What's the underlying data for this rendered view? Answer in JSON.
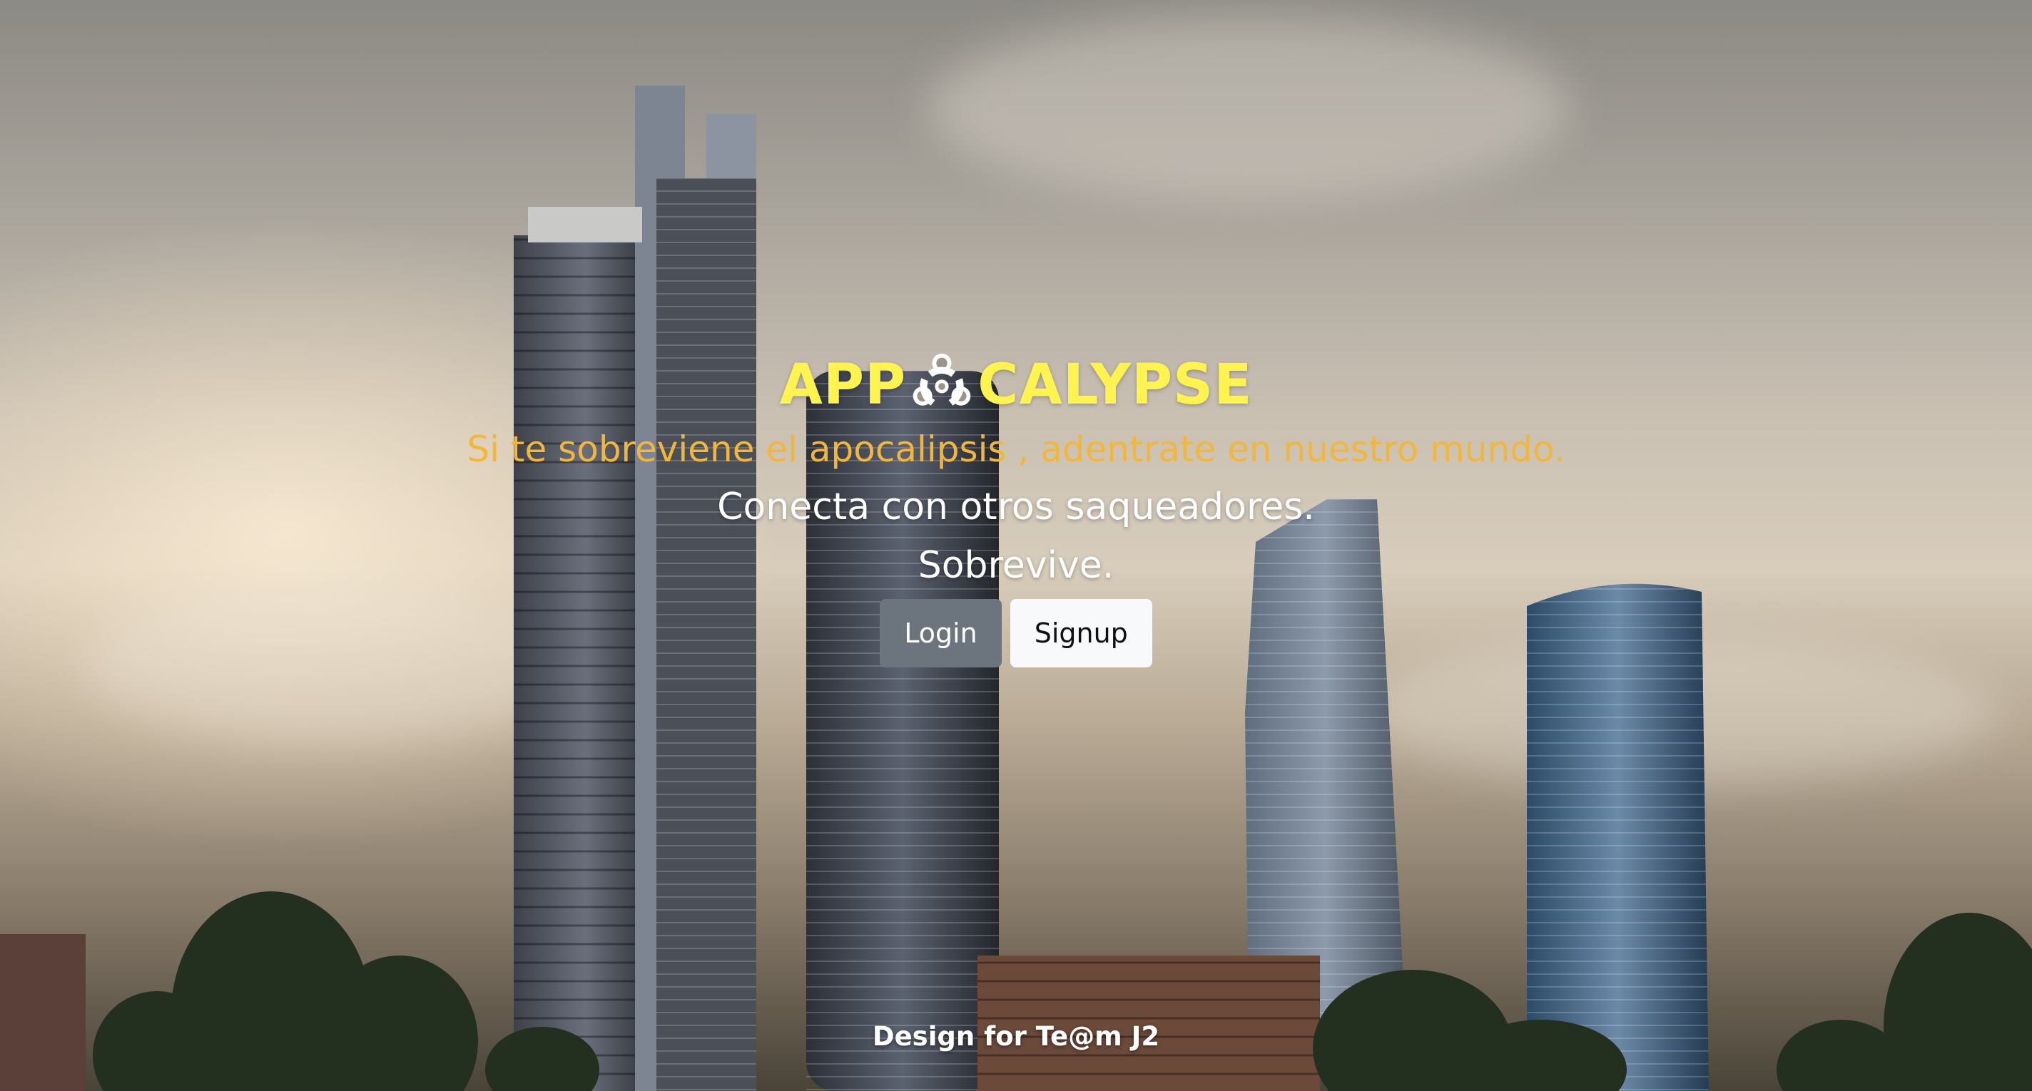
{
  "hero": {
    "brand_left": "APP",
    "brand_icon": "biohazard-icon",
    "brand_right": "CALYPSE",
    "tagline": "Si te sobreviene el apocalipsis , adentrate en nuestro mundo.",
    "line2": "Conecta con otros saqueadores.",
    "line3": "Sobrevive."
  },
  "buttons": {
    "login_label": "Login",
    "signup_label": "Signup"
  },
  "footer": {
    "text": "Design for Te@m J2"
  },
  "colors": {
    "brand": "#fff44f",
    "tagline": "#f2b73a",
    "login_bg": "#6c757d",
    "signup_bg": "#f8f9fa"
  }
}
